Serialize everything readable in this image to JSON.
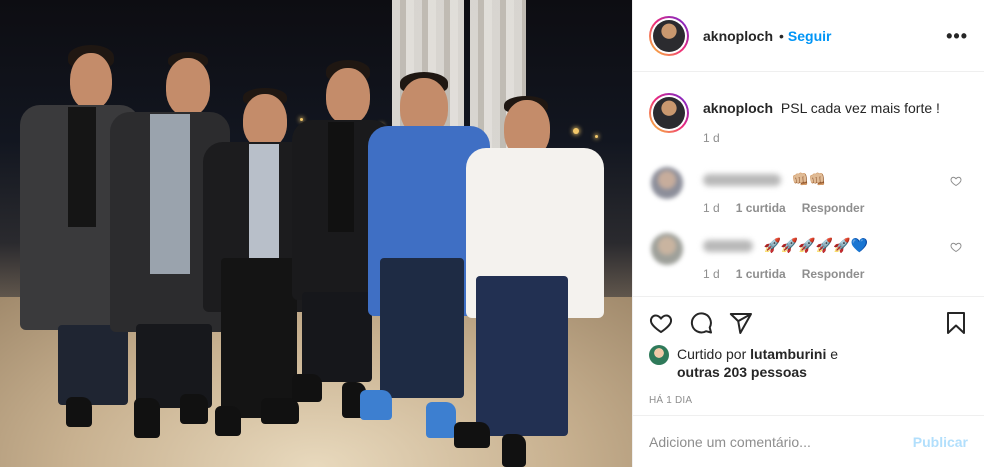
{
  "post": {
    "username": "aknoploch",
    "follow_label": "Seguir",
    "separator": "•",
    "more_label": "•••",
    "caption_user": "aknoploch",
    "caption_text": "PSL cada vez mais forte !",
    "caption_age": "1 d"
  },
  "comments": [
    {
      "emoji": "👊🏼👊🏼",
      "age": "1 d",
      "likes": "1 curtida",
      "reply_label": "Responder"
    },
    {
      "emoji": "🚀🚀🚀🚀🚀💙",
      "age": "1 d",
      "likes": "1 curtida",
      "reply_label": "Responder"
    }
  ],
  "likes": {
    "prefix": "Curtido por",
    "user": "lutamburini",
    "connector": "e",
    "others": "outras 203 pessoas"
  },
  "timestamp": "HÁ 1 DIA",
  "add_comment": {
    "placeholder": "Adicione um comentário...",
    "publish_label": "Publicar"
  },
  "icons": [
    "heart-icon",
    "comment-icon",
    "share-icon",
    "bookmark-icon",
    "more-options-icon"
  ],
  "colors": {
    "accent": "#0095f6",
    "publish_disabled": "#b2dffc",
    "muted": "#8e8e8e",
    "text": "#262626",
    "border": "#efefef"
  }
}
